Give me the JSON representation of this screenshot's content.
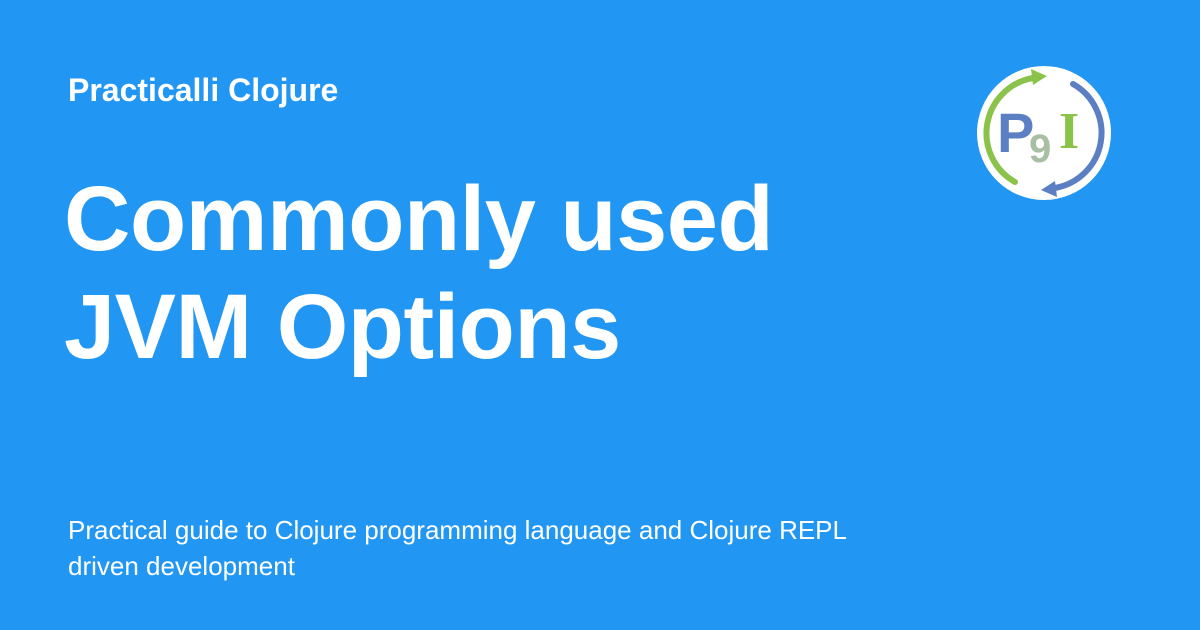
{
  "header": {
    "site_name": "Practicalli Clojure"
  },
  "main": {
    "title_line_1": "Commonly used",
    "title_line_2": "JVM Options",
    "description": "Practical guide to Clojure programming language and Clojure REPL driven development"
  },
  "logo": {
    "icon": "practicalli-logo-icon",
    "letter_p": "P",
    "letter_9": "9",
    "letter_i": "I"
  },
  "colors": {
    "background": "#2196f3",
    "text": "#ffffff",
    "logo_green": "#8bc34a",
    "logo_blue": "#5c7fc4",
    "logo_sage": "#a8bfa3"
  }
}
